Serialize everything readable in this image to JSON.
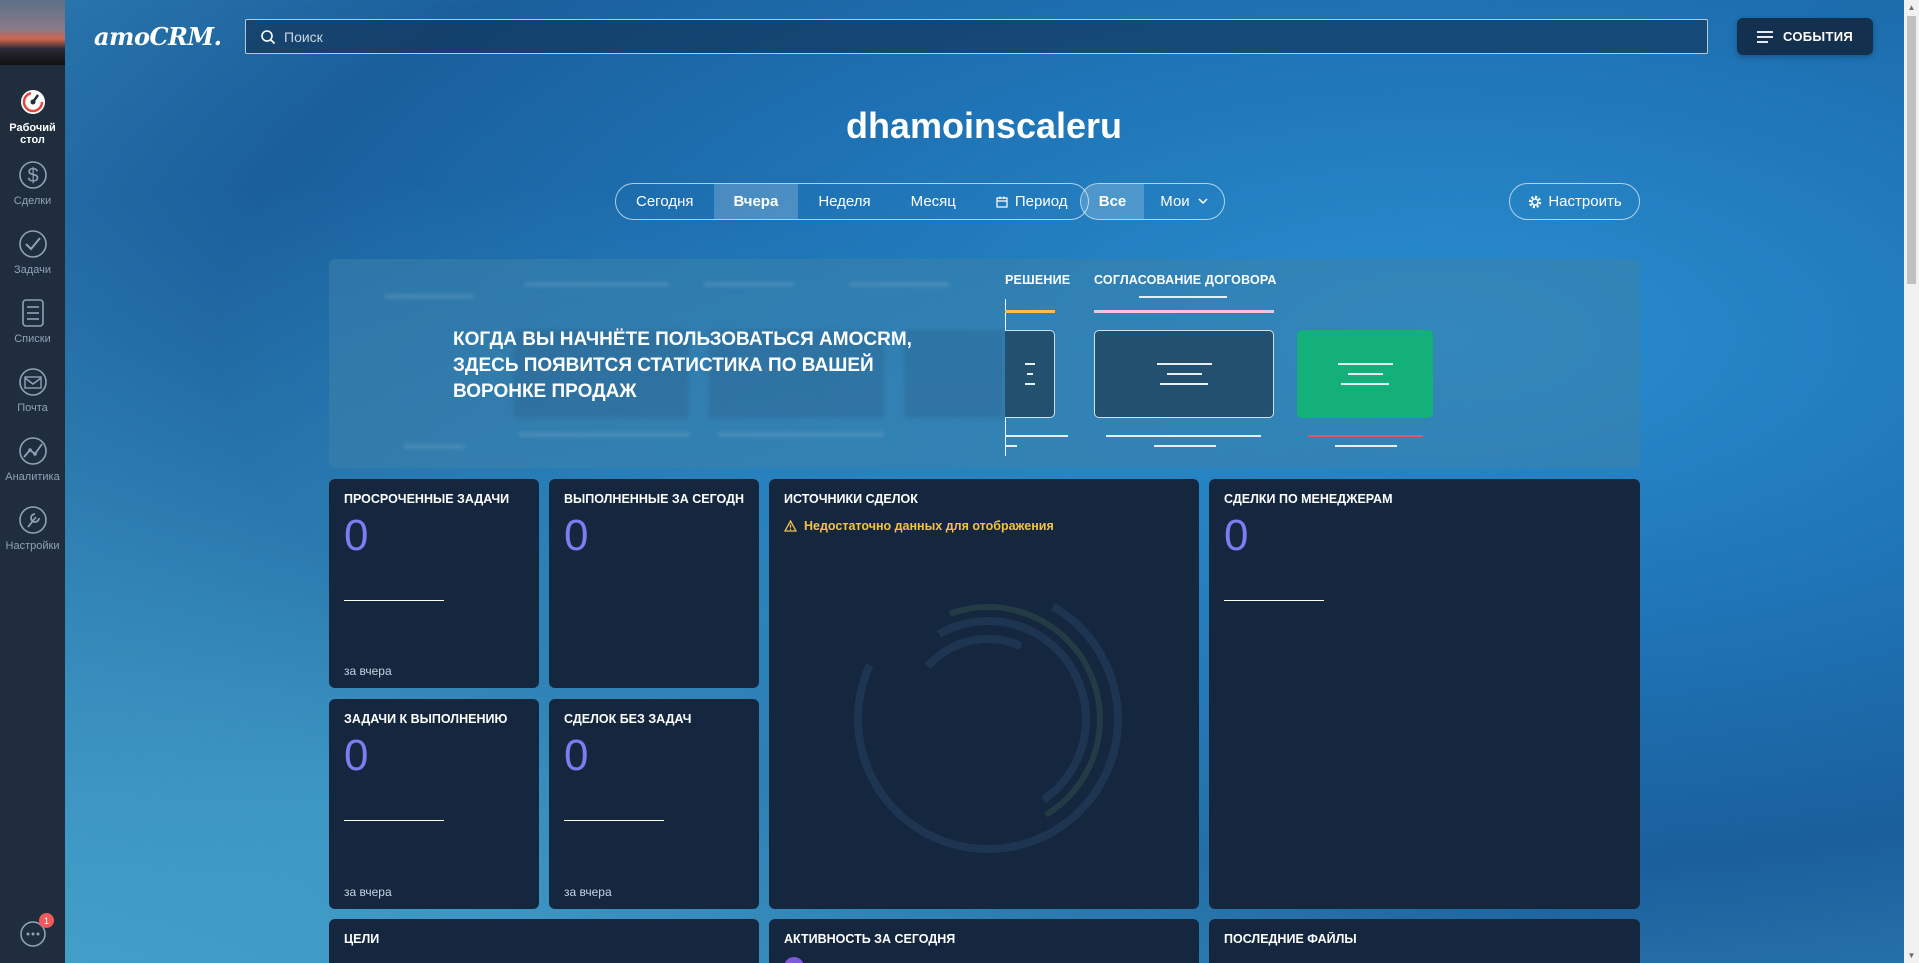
{
  "brand": {
    "logo_text": "amoCRM."
  },
  "search": {
    "placeholder": "Поиск"
  },
  "header": {
    "events_label": "СОБЫТИЯ",
    "page_title": "dhamoinscaleru"
  },
  "sidebar": {
    "items": [
      {
        "label": "Рабочий стол",
        "icon": "dashboard-icon",
        "active": true
      },
      {
        "label": "Сделки",
        "icon": "dollar-icon",
        "active": false
      },
      {
        "label": "Задачи",
        "icon": "checkmark-icon",
        "active": false
      },
      {
        "label": "Списки",
        "icon": "list-icon",
        "active": false
      },
      {
        "label": "Почта",
        "icon": "mail-icon",
        "active": false
      },
      {
        "label": "Аналитика",
        "icon": "analytics-icon",
        "active": false
      },
      {
        "label": "Настройки",
        "icon": "wrench-icon",
        "active": false
      }
    ],
    "chat_badge": "1"
  },
  "filters": {
    "periods": [
      "Сегодня",
      "Вчера",
      "Неделя",
      "Месяц",
      "Период"
    ],
    "selected_period": "Вчера",
    "owners": [
      "Все",
      "Мои"
    ],
    "selected_owner": "Все",
    "setup_label": "Настроить"
  },
  "funnel": {
    "message": "Когда вы начнёте пользоваться amoCRM, здесь появится статистика по вашей воронке продаж",
    "stage_partial": "РЕШЕНИЕ",
    "stage_contract": "СОГЛАСОВАНИЕ ДОГОВОРА",
    "colors": {
      "stage_bar_yellow": "#f3c14a",
      "stage_bar_pink": "#f2c6d6",
      "won_card": "#13b07a",
      "won_underline": "#e0566a"
    }
  },
  "widgets": {
    "overdue": {
      "title": "Просроченные задачи",
      "value": "0",
      "footer": "за вчера"
    },
    "done": {
      "title": "Выполненные за сегодня",
      "value": "0"
    },
    "sources": {
      "title": "Источники сделок",
      "warning": "Недостаточно данных для отображения"
    },
    "managers": {
      "title": "Сделки по менеджерам",
      "value": "0"
    },
    "todo": {
      "title": "Задачи к выполнению",
      "value": "0",
      "footer": "за вчера"
    },
    "no_tasks": {
      "title": "Сделок без задач",
      "value": "0",
      "footer": "за вчера"
    },
    "goals": {
      "title": "Цели"
    },
    "activity": {
      "title": "Активность за сегодня"
    },
    "files": {
      "title": "Последние файлы"
    }
  }
}
